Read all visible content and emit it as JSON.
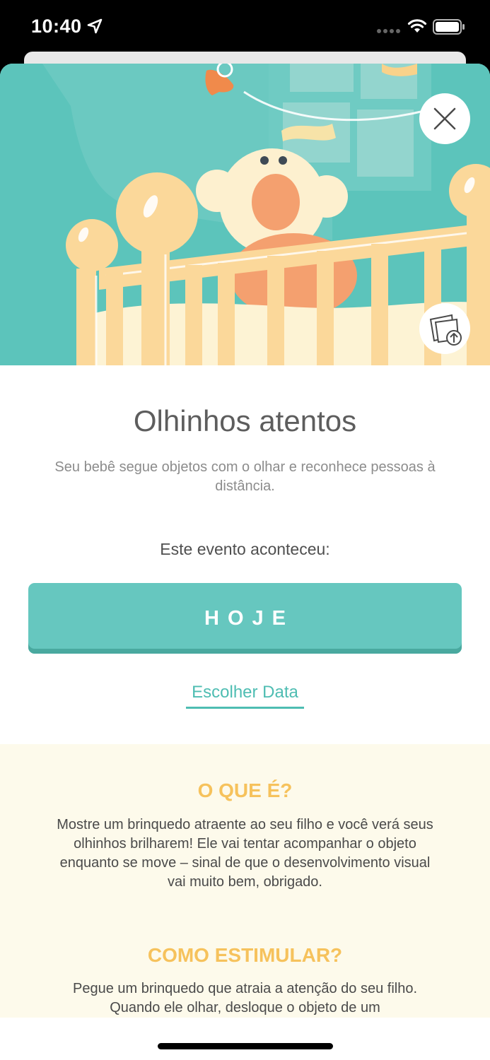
{
  "status": {
    "time": "10:40"
  },
  "icons": {
    "location": "location-arrow-icon",
    "wifi": "wifi-icon",
    "battery": "battery-icon",
    "close": "close-icon",
    "share": "share-photo-icon"
  },
  "milestone": {
    "title": "Olhinhos atentos",
    "subtitle": "Seu bebê segue objetos com o olhar e reconhece pessoas à distância.",
    "event_label": "Este evento aconteceu:",
    "today_button": "HOJE",
    "choose_date": "Escolher Data"
  },
  "info": {
    "what_heading": "O QUE É?",
    "what_text": "Mostre um brinquedo atraente ao seu filho e você verá seus olhinhos brilharem! Ele vai tentar acompanhar o objeto enquanto se move – sinal de que o desenvolvimento visual vai muito bem, obrigado.",
    "how_heading": "COMO ESTIMULAR?",
    "how_text": "Pegue um brinquedo que atraia a atenção do seu filho. Quando ele olhar, desloque o objeto de um"
  },
  "colors": {
    "teal": "#66c7bf",
    "accent_yellow": "#f6c25c",
    "info_bg": "#fdfaeb"
  }
}
